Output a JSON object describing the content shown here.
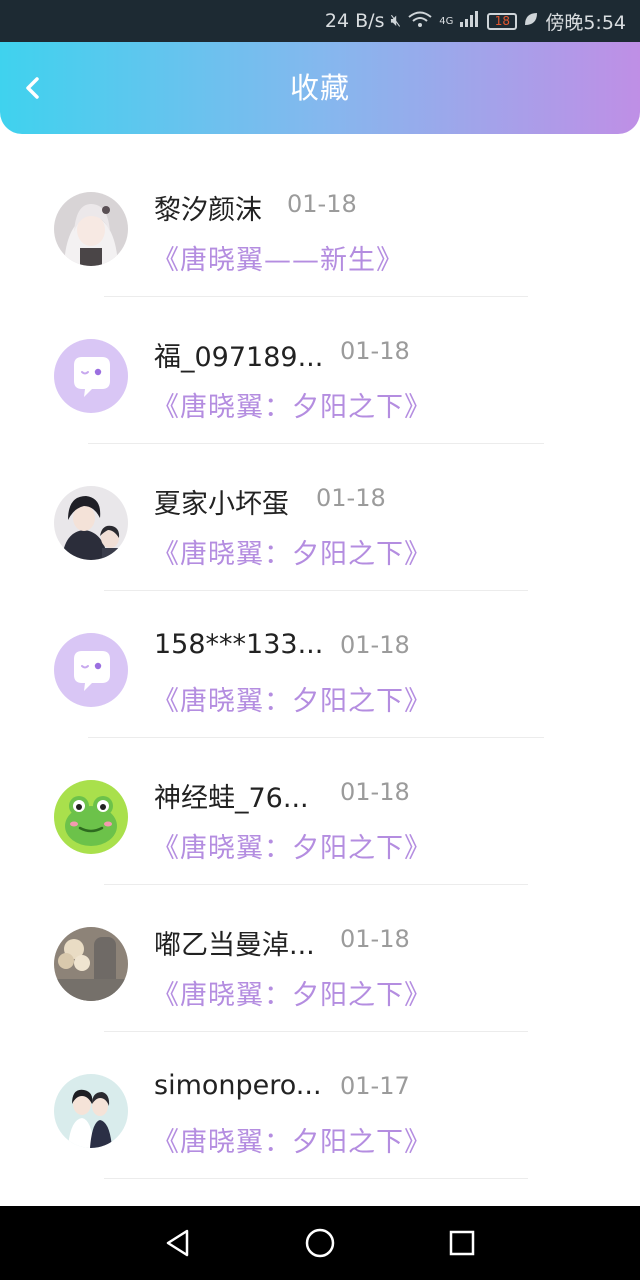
{
  "status_bar": {
    "speed": "24 B/s",
    "network": "4G",
    "battery": "18",
    "time": "傍晚5:54"
  },
  "header": {
    "title": "收藏"
  },
  "items": [
    {
      "user": "黎汐颜沫",
      "date": "01-18",
      "book": "《唐晓翼——新生》"
    },
    {
      "user": "福_097189...",
      "date": "01-18",
      "book": "《唐晓翼：夕阳之下》"
    },
    {
      "user": "夏家小坏蛋",
      "date": "01-18",
      "book": "《唐晓翼：夕阳之下》"
    },
    {
      "user": "158***133...",
      "date": "01-18",
      "book": "《唐晓翼：夕阳之下》"
    },
    {
      "user": "神经蛙_76...",
      "date": "01-18",
      "book": "《唐晓翼：夕阳之下》"
    },
    {
      "user": "嘟乙当曼淖...",
      "date": "01-18",
      "book": "《唐晓翼：夕阳之下》"
    },
    {
      "user": "simonpero...",
      "date": "01-17",
      "book": "《唐晓翼：夕阳之下》"
    }
  ],
  "colors": {
    "header_gradient_start": "#3fd2ee",
    "header_gradient_end": "#bf8fe6",
    "book_title": "#b48de0",
    "date": "#9b9b9b"
  }
}
